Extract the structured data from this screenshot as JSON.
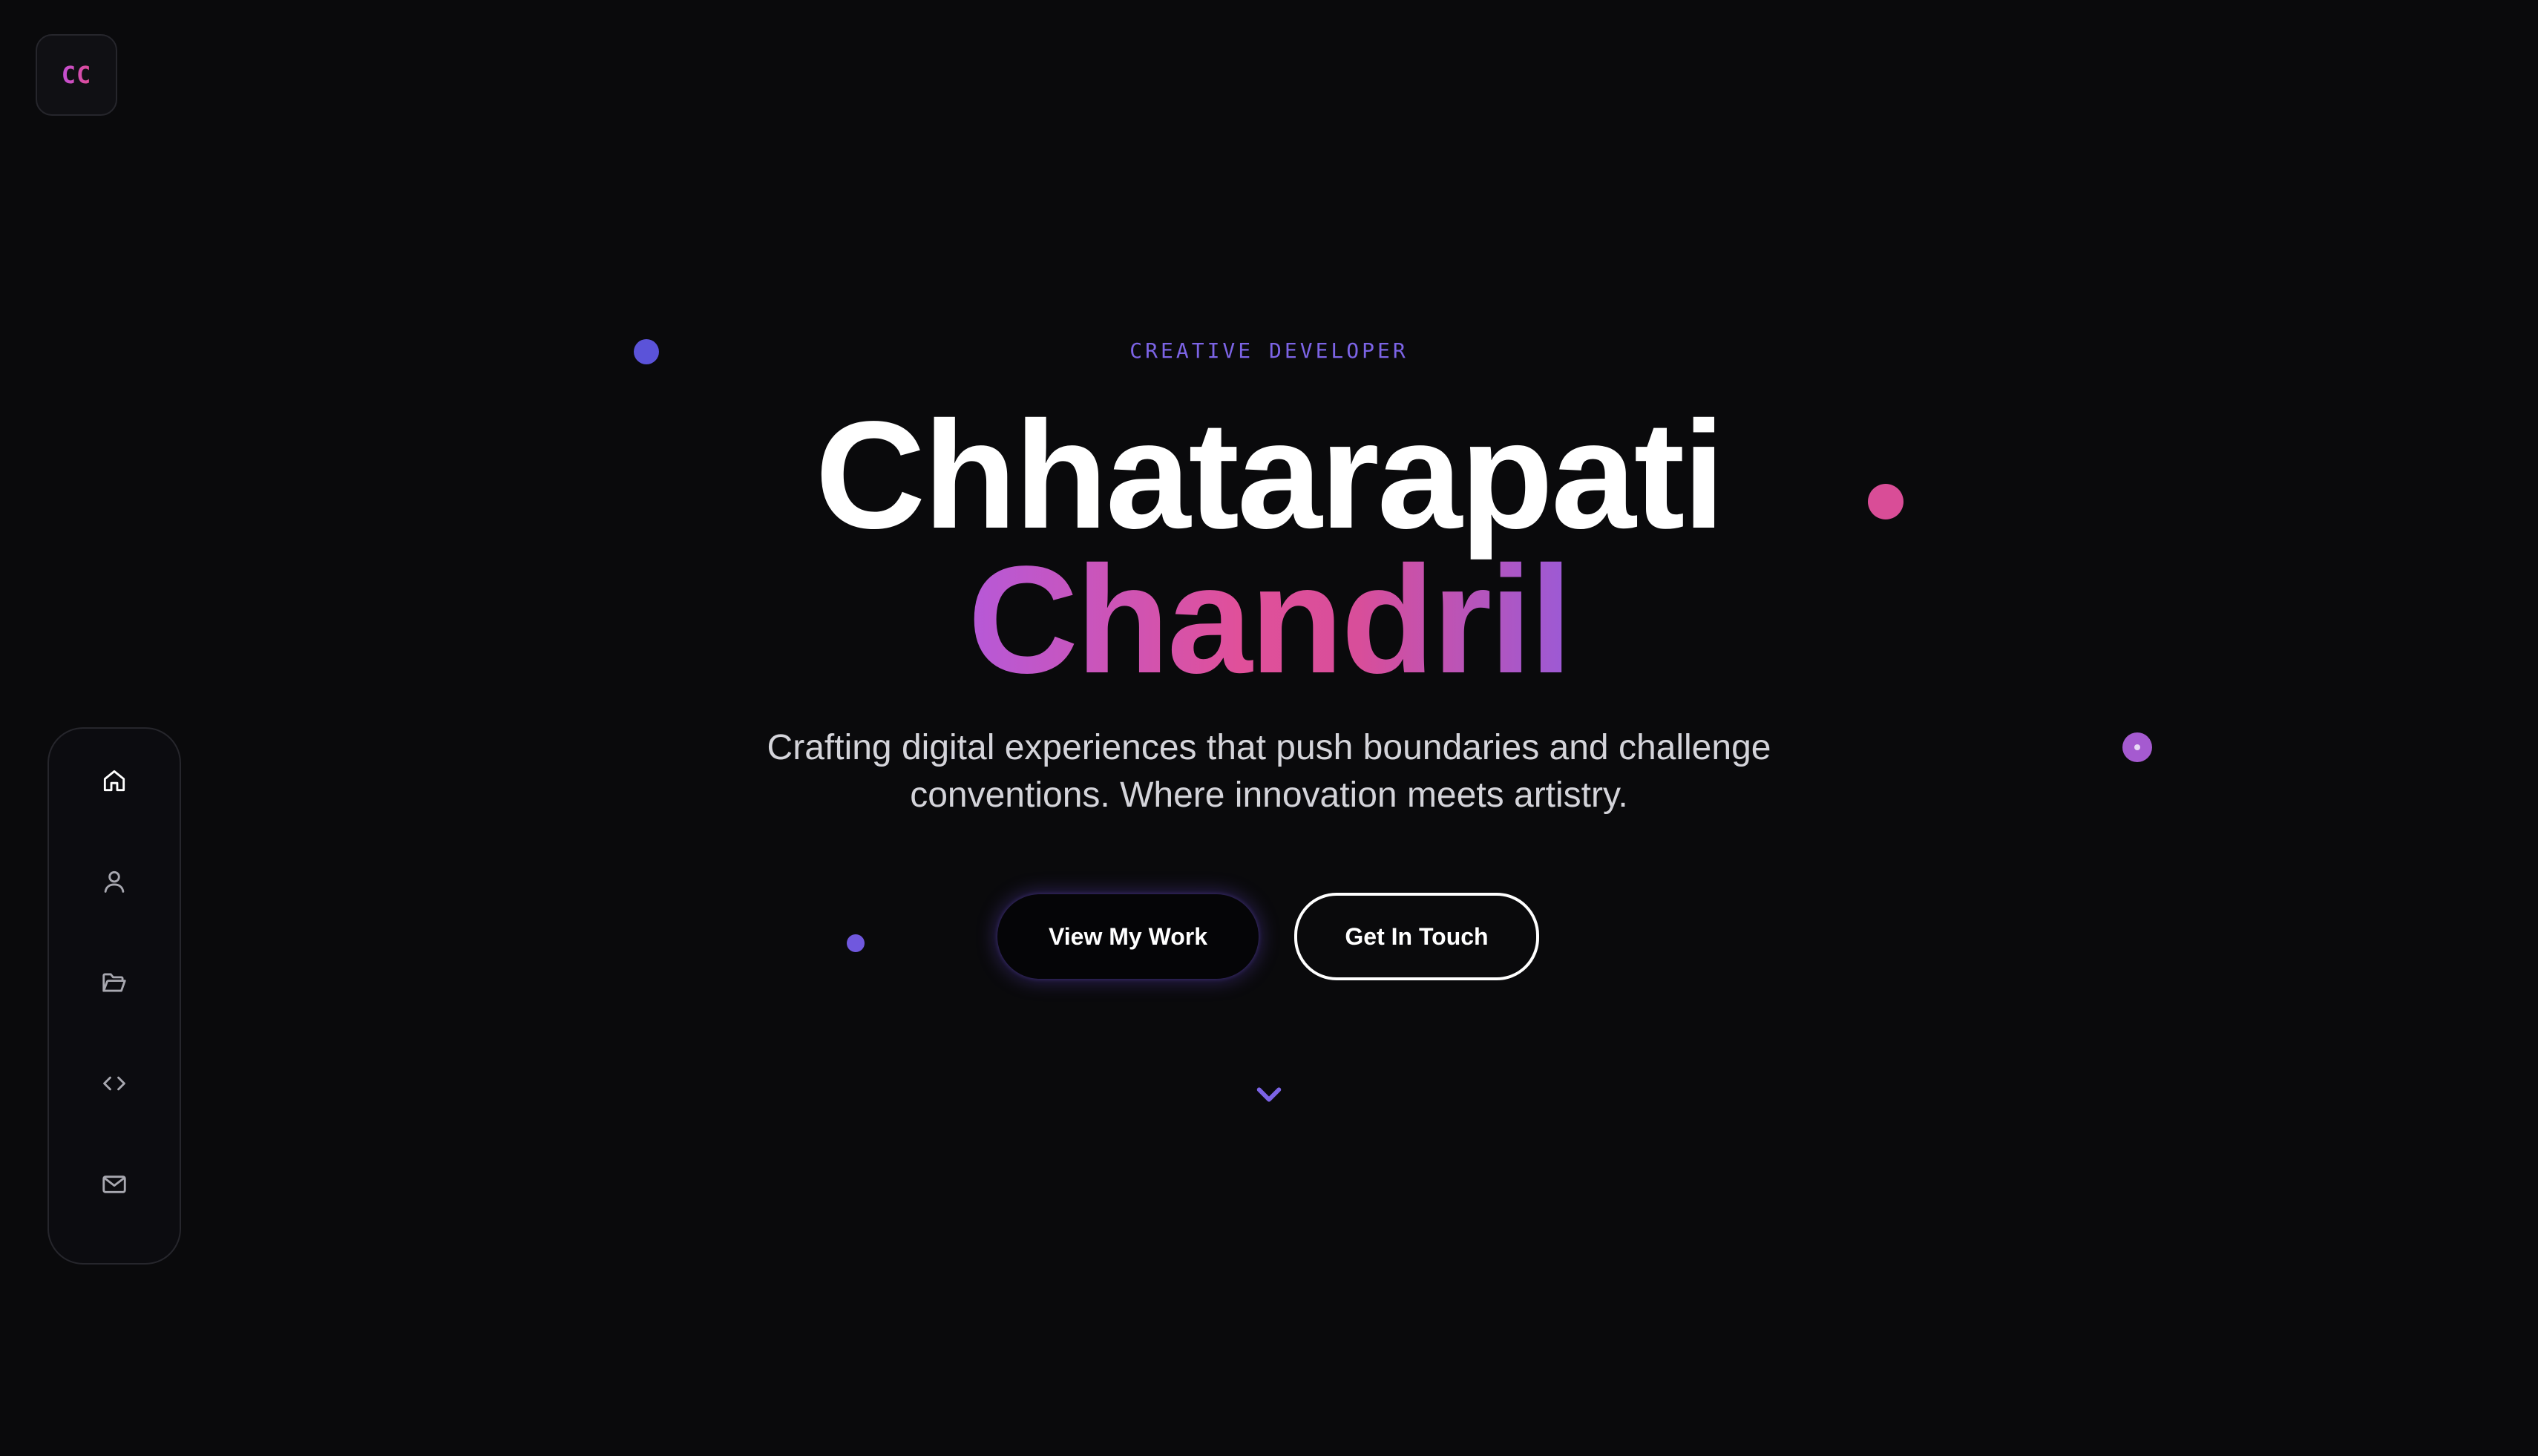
{
  "logo": {
    "text": "CC"
  },
  "sidebar": {
    "items": [
      {
        "icon": "home-icon",
        "label": "Home",
        "active": true
      },
      {
        "icon": "user-icon",
        "label": "About",
        "active": false
      },
      {
        "icon": "folder-icon",
        "label": "Projects",
        "active": false
      },
      {
        "icon": "code-icon",
        "label": "Skills",
        "active": false
      },
      {
        "icon": "mail-icon",
        "label": "Contact",
        "active": false
      }
    ]
  },
  "hero": {
    "eyebrow": "CREATIVE DEVELOPER",
    "first_name": "Chhatarapati",
    "last_name": "Chandril",
    "subtitle": "Crafting digital experiences that push boundaries and challenge conventions. Where innovation meets artistry.",
    "primary_button": "View My Work",
    "secondary_button": "Get In Touch"
  },
  "scroll_indicator": {
    "icon": "chevron-down-icon"
  },
  "colors": {
    "background": "#0a0a0c",
    "accent_purple": "#7c64e6",
    "accent_pink": "#e0509a",
    "accent_violet": "#b659d8"
  }
}
